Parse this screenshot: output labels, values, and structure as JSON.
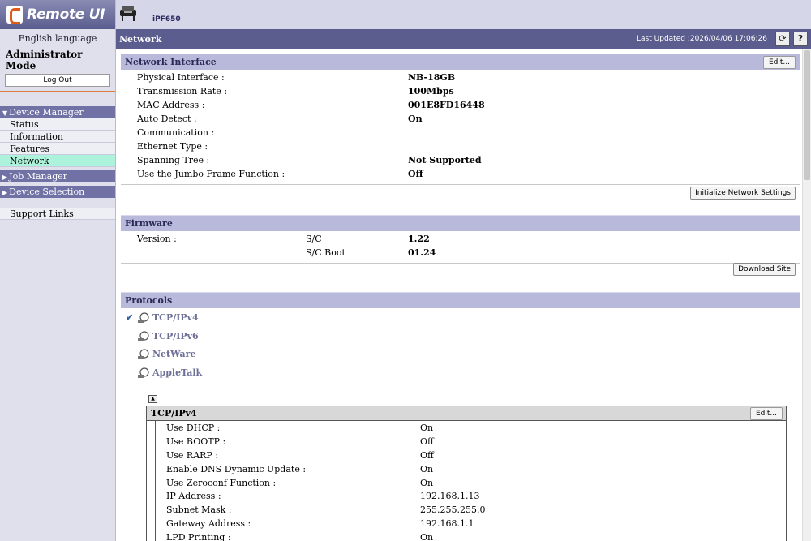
{
  "app": {
    "logo_text": "Remote UI",
    "language": "English language",
    "mode": "Administrator Mode",
    "logout_label": "Log Out",
    "model": "iPF650"
  },
  "sidebar": {
    "groups": [
      {
        "label": "Device Manager",
        "expanded": true,
        "items": [
          {
            "label": "Status"
          },
          {
            "label": "Information"
          },
          {
            "label": "Features"
          },
          {
            "label": "Network",
            "active": true
          }
        ]
      },
      {
        "label": "Job Manager",
        "expanded": false
      },
      {
        "label": "Device Selection",
        "expanded": false
      }
    ],
    "support_label": "Support Links"
  },
  "header": {
    "title": "Network",
    "last_updated": "Last Updated :2026/04/06 17:06:26",
    "refresh_icon": "refresh-icon",
    "help_label": "?"
  },
  "network_interface": {
    "title": "Network Interface",
    "edit_label": "Edit...",
    "rows": [
      {
        "label": "Physical Interface :",
        "value": "NB-18GB"
      },
      {
        "label": "Transmission Rate :",
        "value": "100Mbps"
      },
      {
        "label": "MAC Address :",
        "value": "001E8FD16448"
      },
      {
        "label": "Auto Detect :",
        "value": "On"
      },
      {
        "label": "Communication :",
        "value": ""
      },
      {
        "label": "Ethernet Type :",
        "value": ""
      },
      {
        "label": "Spanning Tree :",
        "value": "Not Supported"
      },
      {
        "label": "Use the Jumbo Frame Function :",
        "value": "Off"
      }
    ],
    "init_button": "Initialize Network Settings"
  },
  "firmware": {
    "title": "Firmware",
    "version_label": "Version :",
    "rows": [
      {
        "component": "S/C",
        "value": "1.22"
      },
      {
        "component": "S/C Boot",
        "value": "01.24"
      }
    ],
    "download_button": "Download Site"
  },
  "protocols": {
    "title": "Protocols",
    "items": [
      {
        "label": "TCP/IPv4",
        "selected": true
      },
      {
        "label": "TCP/IPv6",
        "selected": false
      },
      {
        "label": "NetWare",
        "selected": false
      },
      {
        "label": "AppleTalk",
        "selected": false
      }
    ],
    "collapse_symbol": "▲"
  },
  "tcpipv4": {
    "title": "TCP/IPv4",
    "edit_label": "Edit...",
    "rows": [
      {
        "label": "Use DHCP :",
        "value": "On"
      },
      {
        "label": "Use BOOTP :",
        "value": "Off"
      },
      {
        "label": "Use RARP :",
        "value": "Off"
      },
      {
        "label": "Enable DNS Dynamic Update :",
        "value": "On"
      },
      {
        "label": "Use Zeroconf Function :",
        "value": "On"
      },
      {
        "label": "IP Address :",
        "value": "192.168.1.13"
      },
      {
        "label": "Subnet Mask :",
        "value": "255.255.255.0"
      },
      {
        "label": "Gateway Address :",
        "value": "192.168.1.1"
      },
      {
        "label": "LPD Printing :",
        "value": "On"
      }
    ]
  },
  "colors": {
    "header_bar": "#5b5d8e",
    "section_head": "#b9badb",
    "nav_active": "#adf2da",
    "accent_orange": "#e07a3a"
  }
}
